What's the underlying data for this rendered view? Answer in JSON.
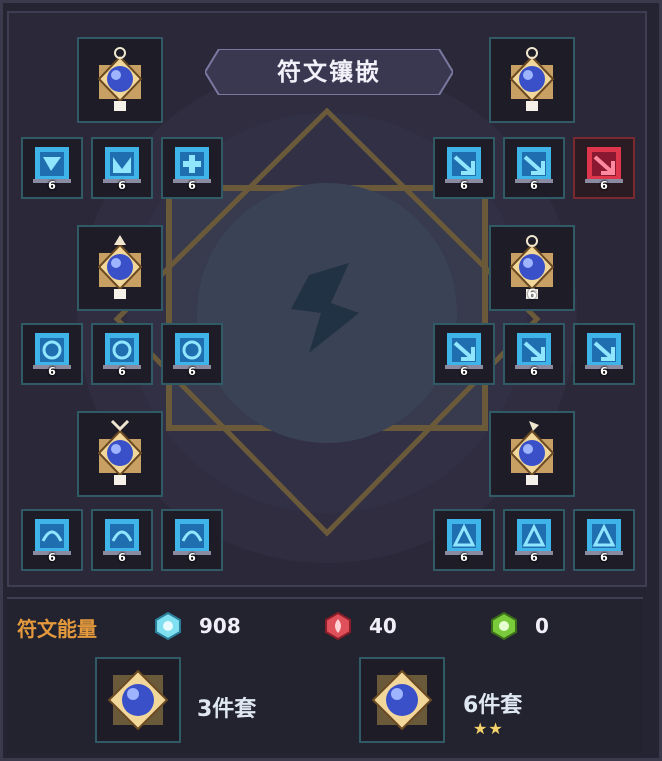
{
  "title": "符文镶嵌",
  "groups": [
    {
      "runes": [
        {
          "level": "6",
          "color": "blue"
        },
        {
          "level": "6",
          "color": "blue"
        },
        {
          "level": "6",
          "color": "blue"
        }
      ]
    },
    {
      "runes": [
        {
          "level": "6",
          "color": "blue"
        },
        {
          "level": "6",
          "color": "blue"
        },
        {
          "level": "6",
          "color": "red"
        }
      ]
    },
    {
      "runes": [
        {
          "level": "6",
          "color": "blue"
        },
        {
          "level": "6",
          "color": "blue"
        },
        {
          "level": "6",
          "color": "blue"
        }
      ]
    },
    {
      "level": "6",
      "runes": [
        {
          "level": "6",
          "color": "blue"
        },
        {
          "level": "6",
          "color": "blue"
        },
        {
          "level": "6",
          "color": "blue"
        }
      ]
    },
    {
      "runes": [
        {
          "level": "6",
          "color": "blue"
        },
        {
          "level": "6",
          "color": "blue"
        },
        {
          "level": "6",
          "color": "blue"
        }
      ]
    },
    {
      "runes": [
        {
          "level": "6",
          "color": "blue"
        },
        {
          "level": "6",
          "color": "blue"
        },
        {
          "level": "6",
          "color": "blue"
        }
      ]
    }
  ],
  "energy": {
    "label": "符文能量",
    "items": [
      {
        "icon": "blue-energy-icon",
        "value": "908",
        "color": "#7fe0f0"
      },
      {
        "icon": "red-energy-icon",
        "value": "40",
        "color": "#e0505a"
      },
      {
        "icon": "green-energy-icon",
        "value": "0",
        "color": "#7acb3c"
      }
    ]
  },
  "sets": [
    {
      "label": "3件套",
      "stars": ""
    },
    {
      "label": "6件套",
      "stars": "★★"
    }
  ],
  "colors": {
    "accent": "#e49a3c",
    "slot_border": "#2f5a66",
    "rune_blue": "#3fb4e8",
    "rune_red": "#e0364c"
  }
}
